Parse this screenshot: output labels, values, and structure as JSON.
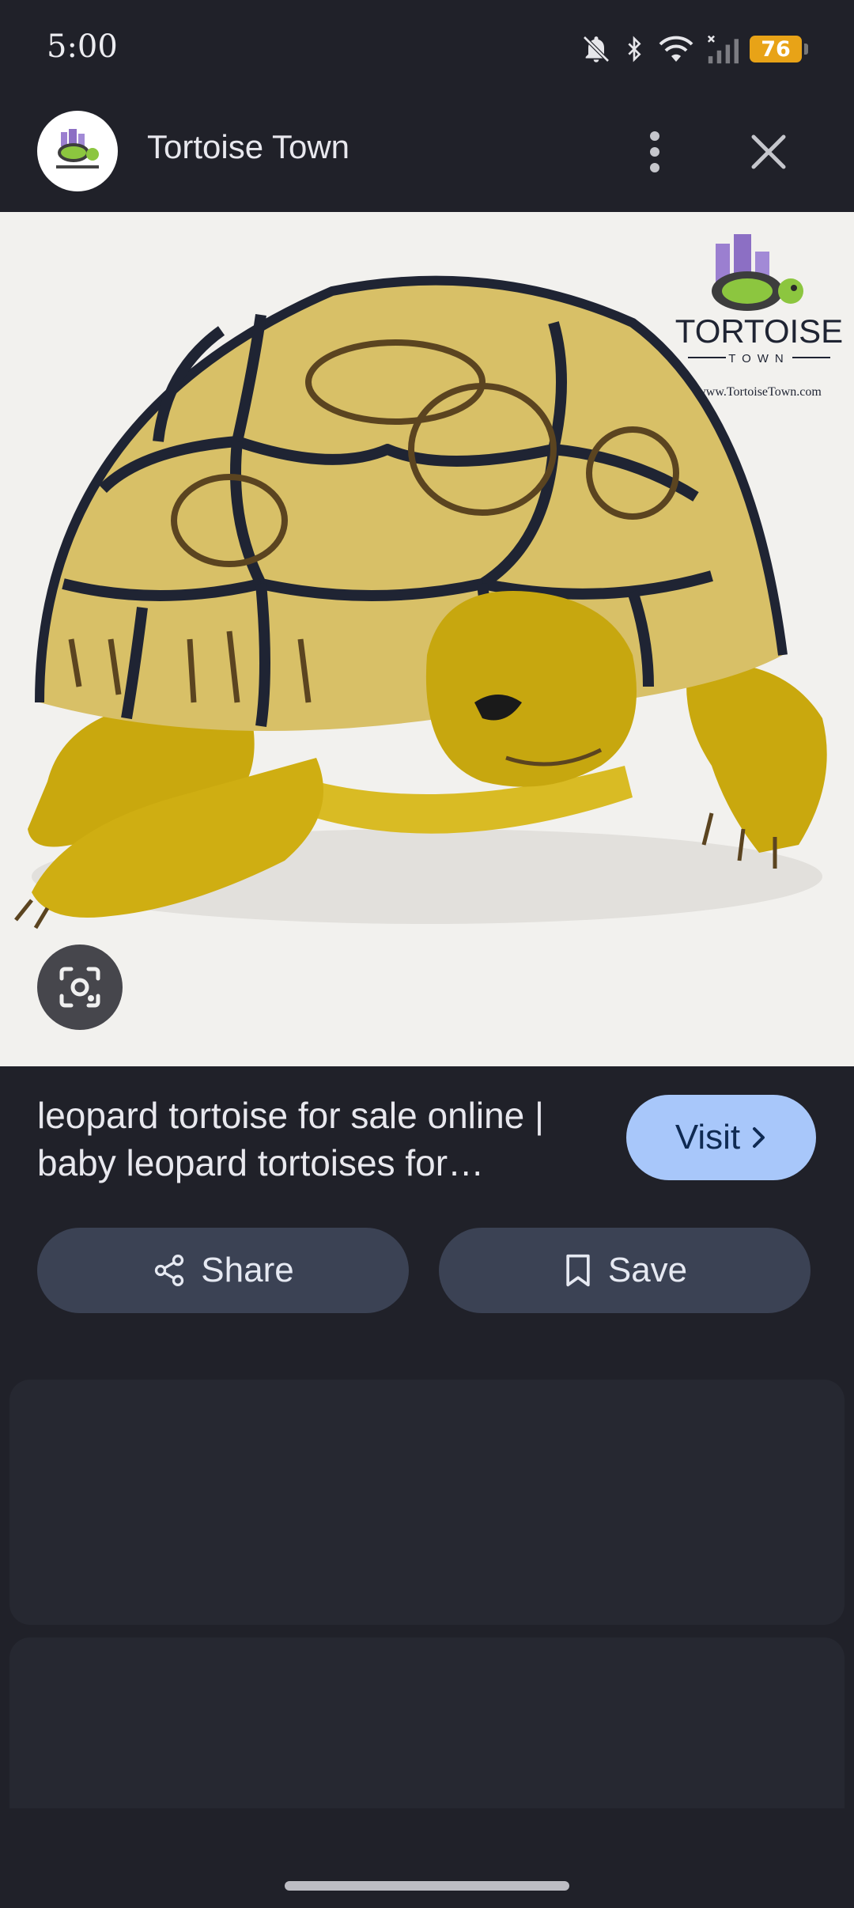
{
  "status_bar": {
    "time": "5:00",
    "battery": "76",
    "icons": [
      "bell-off-icon",
      "bluetooth-icon",
      "wifi-icon",
      "signal-icon",
      "battery-icon"
    ]
  },
  "header": {
    "site_name": "Tortoise Town",
    "avatar_icon": "tortoise-town-logo",
    "more_icon": "more-vertical-icon",
    "close_icon": "close-icon"
  },
  "image": {
    "logo_text": "TORTOISE",
    "logo_subtext": "TOWN",
    "logo_url": "www.TortoiseTown.com",
    "lens_icon": "google-lens-icon"
  },
  "result": {
    "title": "leopard tortoise for sale online | baby leopard tortoises for…",
    "visit_label": "Visit"
  },
  "actions": {
    "share_label": "Share",
    "save_label": "Save"
  },
  "colors": {
    "background": "#202129",
    "visit_button": "#a8c7fa",
    "action_button": "#3b4254"
  }
}
